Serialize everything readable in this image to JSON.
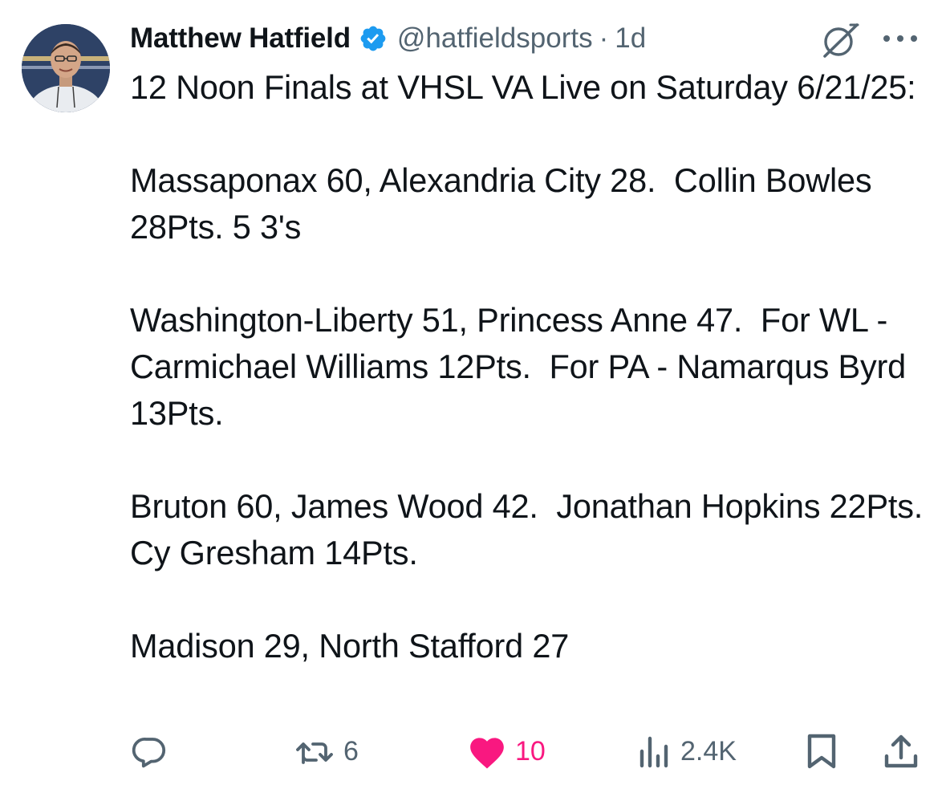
{
  "tweet": {
    "author_name": "Matthew Hatfield",
    "handle": "@hatfieldsports",
    "separator": "·",
    "time": "1d",
    "paragraphs": [
      "12 Noon Finals at VHSL VA Live on Saturday 6/21/25:",
      "Massaponax 60, Alexandria City 28.  Collin Bowles 28Pts. 5 3's",
      "Washington-Liberty 51, Princess Anne 47.  For WL - Carmichael Williams 12Pts.  For PA - Namarqus Byrd 13Pts.",
      "Bruton 60, James Wood 42.  Jonathan Hopkins 22Pts.  Cy Gresham 14Pts.",
      "Madison 29, North Stafford 27"
    ]
  },
  "actions": {
    "retweets": "6",
    "likes": "10",
    "views": "2.4K"
  },
  "colors": {
    "text": "#0f1419",
    "secondary": "#536471",
    "verified": "#1d9bf0",
    "like": "#f91880"
  },
  "icons": [
    "verified-badge-icon",
    "grok-icon",
    "more-icon",
    "reply-icon",
    "retweet-icon",
    "like-icon",
    "views-icon",
    "bookmark-icon",
    "share-icon"
  ]
}
